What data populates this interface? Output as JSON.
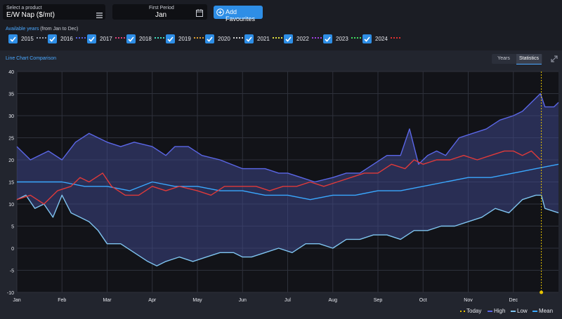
{
  "header": {
    "product_label": "Select a product",
    "product_value": "E/W Nap ($/mt)",
    "period_label": "First Period",
    "period_value": "Jan",
    "add_favourites": "Add Favourites"
  },
  "years_panel": {
    "title_main": "Available years",
    "title_sub": "(from Jan to Dec)",
    "years": [
      {
        "label": "2015",
        "color": "#9aa0ad"
      },
      {
        "label": "2016",
        "color": "#5560e0"
      },
      {
        "label": "2017",
        "color": "#e0407a"
      },
      {
        "label": "2018",
        "color": "#40e0c0"
      },
      {
        "label": "2019",
        "color": "#e0a030"
      },
      {
        "label": "2020",
        "color": "#d0d0d0"
      },
      {
        "label": "2021",
        "color": "#e0e040"
      },
      {
        "label": "2022",
        "color": "#a040e0"
      },
      {
        "label": "2023",
        "color": "#40e060"
      },
      {
        "label": "2024",
        "color": "#e03030"
      }
    ]
  },
  "chart_panel": {
    "title": "Line Chart Comparison",
    "tabs": [
      "Years",
      "Statistics"
    ],
    "active_tab": "Statistics"
  },
  "legend": {
    "today": "Today",
    "high": "High",
    "low": "Low",
    "mean": "Mean"
  },
  "chart_data": {
    "type": "line",
    "x_tick_labels": [
      "Jan",
      "Feb",
      "Mar",
      "Apr",
      "May",
      "Jun",
      "Jul",
      "Aug",
      "Sep",
      "Oct",
      "Nov",
      "Dec"
    ],
    "y_tick_labels": [
      "40",
      "35",
      "30",
      "25",
      "20",
      "15",
      "10",
      "5",
      "0",
      "-5",
      "-10"
    ],
    "ylim": [
      -10,
      40
    ],
    "xlim": [
      0,
      12
    ],
    "grid": true,
    "today_x": 11.62,
    "series": [
      {
        "name": "High",
        "color": "#5b67e8",
        "points": [
          [
            0,
            23
          ],
          [
            0.3,
            20
          ],
          [
            0.7,
            22
          ],
          [
            1.0,
            20
          ],
          [
            1.3,
            24
          ],
          [
            1.6,
            26
          ],
          [
            2.0,
            24
          ],
          [
            2.3,
            23
          ],
          [
            2.6,
            24
          ],
          [
            3.0,
            23
          ],
          [
            3.3,
            21
          ],
          [
            3.5,
            23
          ],
          [
            3.8,
            23
          ],
          [
            4.1,
            21
          ],
          [
            4.5,
            20
          ],
          [
            5.0,
            18
          ],
          [
            5.5,
            18
          ],
          [
            5.8,
            17
          ],
          [
            6.0,
            17
          ],
          [
            6.3,
            16
          ],
          [
            6.6,
            15
          ],
          [
            7.0,
            16
          ],
          [
            7.3,
            17
          ],
          [
            7.6,
            17
          ],
          [
            7.9,
            19
          ],
          [
            8.2,
            21
          ],
          [
            8.5,
            21
          ],
          [
            8.7,
            27
          ],
          [
            8.9,
            19
          ],
          [
            9.1,
            21
          ],
          [
            9.3,
            22
          ],
          [
            9.5,
            21
          ],
          [
            9.8,
            25
          ],
          [
            10.1,
            26
          ],
          [
            10.4,
            27
          ],
          [
            10.7,
            29
          ],
          [
            11.0,
            30
          ],
          [
            11.2,
            31
          ],
          [
            11.4,
            33
          ],
          [
            11.6,
            35
          ],
          [
            11.7,
            32
          ],
          [
            11.9,
            32
          ],
          [
            12,
            33
          ]
        ]
      },
      {
        "name": "Low",
        "color": "#7fc4f0",
        "points": [
          [
            0,
            11
          ],
          [
            0.2,
            12
          ],
          [
            0.4,
            9
          ],
          [
            0.6,
            10
          ],
          [
            0.8,
            7
          ],
          [
            1.0,
            12
          ],
          [
            1.2,
            8
          ],
          [
            1.4,
            7
          ],
          [
            1.6,
            6
          ],
          [
            1.8,
            4
          ],
          [
            2.0,
            1
          ],
          [
            2.3,
            1
          ],
          [
            2.6,
            -1
          ],
          [
            2.9,
            -3
          ],
          [
            3.1,
            -4
          ],
          [
            3.3,
            -3
          ],
          [
            3.6,
            -2
          ],
          [
            3.9,
            -3
          ],
          [
            4.2,
            -2
          ],
          [
            4.5,
            -1
          ],
          [
            4.8,
            -1
          ],
          [
            5.0,
            -2
          ],
          [
            5.2,
            -2
          ],
          [
            5.5,
            -1
          ],
          [
            5.8,
            0
          ],
          [
            6.1,
            -1
          ],
          [
            6.4,
            1
          ],
          [
            6.7,
            1
          ],
          [
            7.0,
            0
          ],
          [
            7.3,
            2
          ],
          [
            7.6,
            2
          ],
          [
            7.9,
            3
          ],
          [
            8.2,
            3
          ],
          [
            8.5,
            2
          ],
          [
            8.8,
            4
          ],
          [
            9.1,
            4
          ],
          [
            9.4,
            5
          ],
          [
            9.7,
            5
          ],
          [
            10.0,
            6
          ],
          [
            10.3,
            7
          ],
          [
            10.6,
            9
          ],
          [
            10.9,
            8
          ],
          [
            11.2,
            11
          ],
          [
            11.5,
            12
          ],
          [
            11.62,
            12
          ],
          [
            11.7,
            9
          ],
          [
            12,
            8
          ]
        ]
      },
      {
        "name": "Mean",
        "color": "#3aa8ff",
        "points": [
          [
            0,
            15
          ],
          [
            0.5,
            15
          ],
          [
            1.0,
            15
          ],
          [
            1.5,
            14
          ],
          [
            2.0,
            14
          ],
          [
            2.5,
            13
          ],
          [
            3.0,
            15
          ],
          [
            3.5,
            14
          ],
          [
            4.0,
            14
          ],
          [
            4.5,
            13
          ],
          [
            5.0,
            13
          ],
          [
            5.5,
            12
          ],
          [
            6.0,
            12
          ],
          [
            6.5,
            11
          ],
          [
            7.0,
            12
          ],
          [
            7.5,
            12
          ],
          [
            8.0,
            13
          ],
          [
            8.5,
            13
          ],
          [
            9.0,
            14
          ],
          [
            9.5,
            15
          ],
          [
            10.0,
            16
          ],
          [
            10.5,
            16
          ],
          [
            11.0,
            17
          ],
          [
            11.5,
            18
          ],
          [
            12,
            19
          ]
        ]
      },
      {
        "name": "2024",
        "color": "#e03a3a",
        "points": [
          [
            0,
            11
          ],
          [
            0.3,
            12
          ],
          [
            0.6,
            10
          ],
          [
            0.9,
            13
          ],
          [
            1.2,
            14
          ],
          [
            1.4,
            16
          ],
          [
            1.6,
            15
          ],
          [
            1.9,
            17
          ],
          [
            2.1,
            14
          ],
          [
            2.4,
            12
          ],
          [
            2.7,
            12
          ],
          [
            3.0,
            14
          ],
          [
            3.3,
            13
          ],
          [
            3.6,
            14
          ],
          [
            4.0,
            13
          ],
          [
            4.3,
            12
          ],
          [
            4.6,
            14
          ],
          [
            5.0,
            14
          ],
          [
            5.3,
            14
          ],
          [
            5.6,
            13
          ],
          [
            5.9,
            14
          ],
          [
            6.2,
            14
          ],
          [
            6.5,
            15
          ],
          [
            6.8,
            14
          ],
          [
            7.1,
            15
          ],
          [
            7.4,
            16
          ],
          [
            7.7,
            17
          ],
          [
            8.0,
            17
          ],
          [
            8.3,
            19
          ],
          [
            8.6,
            18
          ],
          [
            8.8,
            20
          ],
          [
            9.0,
            19
          ],
          [
            9.3,
            20
          ],
          [
            9.6,
            20
          ],
          [
            9.9,
            21
          ],
          [
            10.2,
            20
          ],
          [
            10.5,
            21
          ],
          [
            10.8,
            22
          ],
          [
            11.0,
            22
          ],
          [
            11.2,
            21
          ],
          [
            11.4,
            22
          ],
          [
            11.6,
            20
          ]
        ]
      }
    ]
  }
}
